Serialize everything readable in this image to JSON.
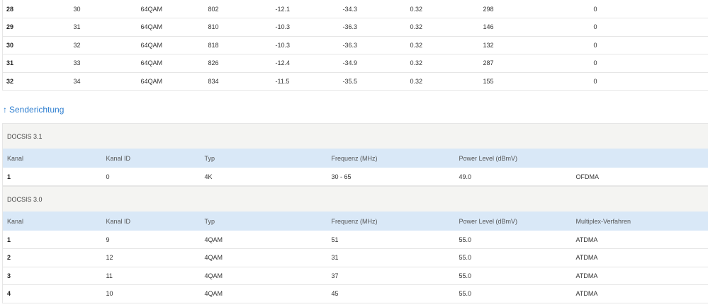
{
  "downstream_rows": [
    [
      "28",
      "30",
      "64QAM",
      "802",
      "-12.1",
      "-34.3",
      "0.32",
      "298",
      "0"
    ],
    [
      "29",
      "31",
      "64QAM",
      "810",
      "-10.3",
      "-36.3",
      "0.32",
      "146",
      "0"
    ],
    [
      "30",
      "32",
      "64QAM",
      "818",
      "-10.3",
      "-36.3",
      "0.32",
      "132",
      "0"
    ],
    [
      "31",
      "33",
      "64QAM",
      "826",
      "-12.4",
      "-34.9",
      "0.32",
      "287",
      "0"
    ],
    [
      "32",
      "34",
      "64QAM",
      "834",
      "-11.5",
      "-35.5",
      "0.32",
      "155",
      "0"
    ]
  ],
  "upstream": {
    "arrow": "↑",
    "heading": "Senderichtung",
    "docsis31": {
      "caption": "DOCSIS 3.1",
      "headers": [
        "Kanal",
        "Kanal ID",
        "Typ",
        "Frequenz (MHz)",
        "Power Level (dBmV)",
        ""
      ],
      "rows": [
        [
          "1",
          "0",
          "4K",
          "30 - 65",
          "49.0",
          "OFDMA"
        ]
      ]
    },
    "docsis30": {
      "caption": "DOCSIS 3.0",
      "headers": [
        "Kanal",
        "Kanal ID",
        "Typ",
        "Frequenz (MHz)",
        "Power Level (dBmV)",
        "Multiplex-Verfahren"
      ],
      "rows": [
        [
          "1",
          "9",
          "4QAM",
          "51",
          "55.0",
          "ATDMA"
        ],
        [
          "2",
          "12",
          "4QAM",
          "31",
          "55.0",
          "ATDMA"
        ],
        [
          "3",
          "11",
          "4QAM",
          "37",
          "55.0",
          "ATDMA"
        ],
        [
          "4",
          "10",
          "4QAM",
          "45",
          "55.0",
          "ATDMA"
        ]
      ]
    }
  },
  "colors": {
    "link": "#2f7fd0",
    "header_bg": "#d9e8f7",
    "section_bg": "#f4f4f2",
    "border": "#e6e6e6"
  }
}
